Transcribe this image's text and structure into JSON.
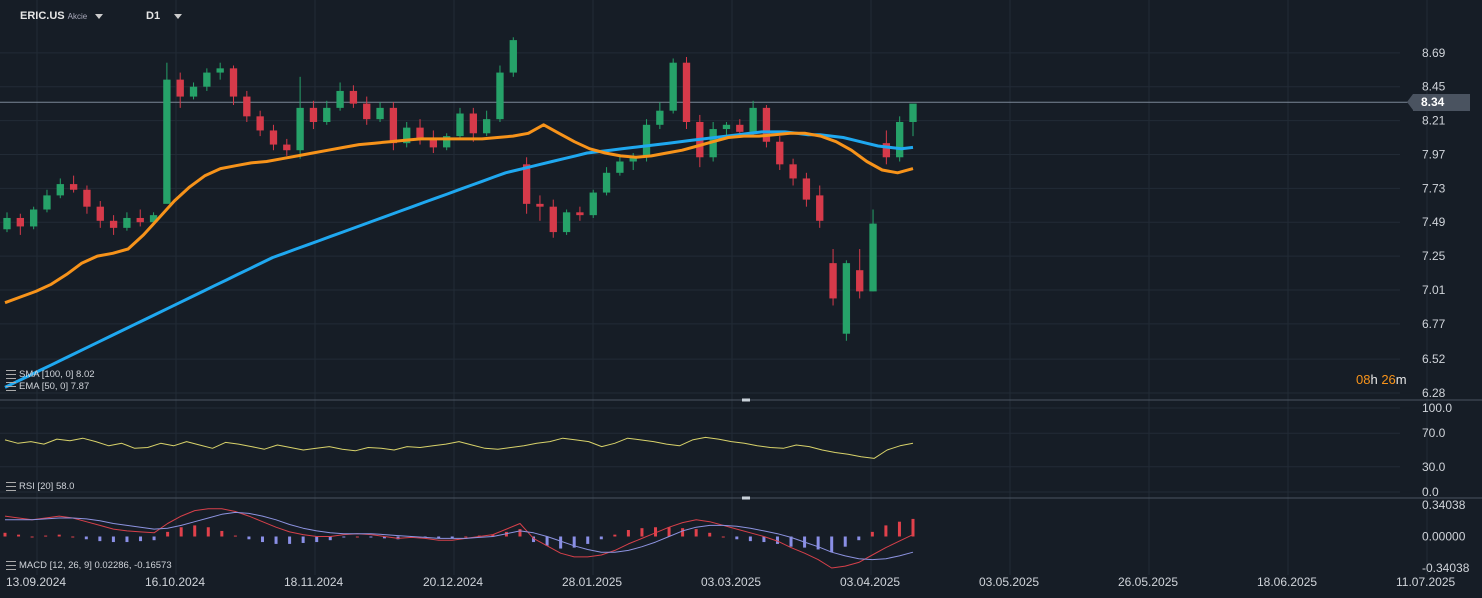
{
  "header": {
    "symbol": "ERIC.US",
    "instrument_type": "Akcie",
    "timeframe": "D1"
  },
  "timer": {
    "hours": "08",
    "h": "h",
    "minutes": "26",
    "m": "m"
  },
  "colors": {
    "background": "#161d26",
    "grid": "#222b36",
    "up_candle": "#26a269",
    "down_candle": "#d63a4a",
    "sma": "#1fa8f0",
    "ema": "#f7931a",
    "rsi": "#d8d26a",
    "macd": "#d6404a",
    "signal": "#8d93e0",
    "hist_pos": "#e0414b",
    "hist_neg": "#8a8fe6"
  },
  "chart_data": [
    {
      "type": "candlestick",
      "title": "ERIC.US",
      "current_price": "8.34",
      "ylim": [
        6.28,
        8.88
      ],
      "y_ticks": [
        "8.69",
        "8.45",
        "8.21",
        "7.97",
        "7.73",
        "7.49",
        "7.25",
        "7.01",
        "6.77",
        "6.52",
        "6.28"
      ],
      "x_ticks": [
        "13.09.2024",
        "16.10.2024",
        "18.11.2024",
        "20.12.2024",
        "28.01.2025",
        "03.03.2025",
        "03.04.2025",
        "03.05.2025",
        "26.05.2025",
        "18.06.2025",
        "11.07.2025"
      ],
      "indicators": [
        {
          "label": "SMA [100, 0] 8.02",
          "value": 8.02
        },
        {
          "label": "EMA [50, 0] 7.87",
          "value": 7.87
        }
      ],
      "sma_series": [
        6.32,
        6.36,
        6.4,
        6.44,
        6.48,
        6.52,
        6.56,
        6.6,
        6.64,
        6.68,
        6.72,
        6.76,
        6.8,
        6.84,
        6.88,
        6.92,
        6.96,
        7.0,
        7.04,
        7.08,
        7.12,
        7.16,
        7.2,
        7.24,
        7.27,
        7.3,
        7.33,
        7.36,
        7.39,
        7.42,
        7.45,
        7.48,
        7.51,
        7.54,
        7.57,
        7.6,
        7.63,
        7.66,
        7.69,
        7.72,
        7.75,
        7.78,
        7.81,
        7.84,
        7.86,
        7.88,
        7.9,
        7.92,
        7.94,
        7.96,
        7.98,
        7.99,
        8.0,
        8.01,
        8.02,
        8.03,
        8.04,
        8.05,
        8.06,
        8.07,
        8.08,
        8.09,
        8.1,
        8.11,
        8.12,
        8.13,
        8.13,
        8.13,
        8.12,
        8.11,
        8.11,
        8.1,
        8.09,
        8.07,
        8.05,
        8.03,
        8.02,
        8.01,
        8.02
      ],
      "ema_series": [
        6.92,
        6.96,
        7.0,
        7.05,
        7.12,
        7.2,
        7.25,
        7.27,
        7.3,
        7.4,
        7.52,
        7.64,
        7.74,
        7.82,
        7.87,
        7.89,
        7.91,
        7.92,
        7.94,
        7.96,
        7.98,
        8.0,
        8.02,
        8.04,
        8.05,
        8.06,
        8.07,
        8.08,
        8.08,
        8.08,
        8.08,
        8.08,
        8.09,
        8.1,
        8.12,
        8.18,
        8.12,
        8.06,
        8.01,
        7.98,
        7.96,
        7.95,
        7.96,
        7.98,
        8.0,
        8.03,
        8.06,
        8.09,
        8.1,
        8.1,
        8.11,
        8.12,
        8.12,
        8.1,
        8.06,
        8.0,
        7.92,
        7.86,
        7.84,
        7.87
      ],
      "candles": [
        [
          7.44,
          7.56,
          7.42,
          7.52
        ],
        [
          7.52,
          7.55,
          7.4,
          7.46
        ],
        [
          7.46,
          7.6,
          7.44,
          7.58
        ],
        [
          7.58,
          7.72,
          7.56,
          7.68
        ],
        [
          7.68,
          7.8,
          7.66,
          7.76
        ],
        [
          7.76,
          7.82,
          7.7,
          7.72
        ],
        [
          7.72,
          7.75,
          7.55,
          7.6
        ],
        [
          7.6,
          7.64,
          7.45,
          7.5
        ],
        [
          7.5,
          7.54,
          7.4,
          7.45
        ],
        [
          7.45,
          7.56,
          7.43,
          7.52
        ],
        [
          7.52,
          7.58,
          7.46,
          7.49
        ],
        [
          7.49,
          7.56,
          7.47,
          7.54
        ],
        [
          7.62,
          8.62,
          7.82,
          8.5
        ],
        [
          8.5,
          8.55,
          8.3,
          8.38
        ],
        [
          8.38,
          8.48,
          8.36,
          8.45
        ],
        [
          8.45,
          8.58,
          8.42,
          8.55
        ],
        [
          8.55,
          8.62,
          8.5,
          8.58
        ],
        [
          8.58,
          8.6,
          8.32,
          8.38
        ],
        [
          8.38,
          8.42,
          8.2,
          8.24
        ],
        [
          8.24,
          8.28,
          8.1,
          8.14
        ],
        [
          8.14,
          8.18,
          8.0,
          8.04
        ],
        [
          8.04,
          8.08,
          7.96,
          8.0
        ],
        [
          8.0,
          8.52,
          7.94,
          8.3
        ],
        [
          8.3,
          8.35,
          8.15,
          8.2
        ],
        [
          8.2,
          8.35,
          8.18,
          8.3
        ],
        [
          8.3,
          8.48,
          8.28,
          8.42
        ],
        [
          8.42,
          8.46,
          8.3,
          8.33
        ],
        [
          8.33,
          8.38,
          8.18,
          8.22
        ],
        [
          8.22,
          8.34,
          8.2,
          8.3
        ],
        [
          8.3,
          8.34,
          8.0,
          8.05
        ],
        [
          8.05,
          8.2,
          8.02,
          8.16
        ],
        [
          8.16,
          8.22,
          8.04,
          8.08
        ],
        [
          8.08,
          8.14,
          7.98,
          8.02
        ],
        [
          8.02,
          8.12,
          8.0,
          8.1
        ],
        [
          8.1,
          8.3,
          8.08,
          8.26
        ],
        [
          8.26,
          8.3,
          8.06,
          8.12
        ],
        [
          8.12,
          8.28,
          8.1,
          8.22
        ],
        [
          8.22,
          8.6,
          8.2,
          8.55
        ],
        [
          8.55,
          8.8,
          8.52,
          8.78
        ],
        [
          7.9,
          7.95,
          7.55,
          7.62
        ],
        [
          7.62,
          7.68,
          7.5,
          7.6
        ],
        [
          7.6,
          7.65,
          7.38,
          7.42
        ],
        [
          7.42,
          7.58,
          7.4,
          7.56
        ],
        [
          7.56,
          7.6,
          7.5,
          7.54
        ],
        [
          7.54,
          7.72,
          7.52,
          7.7
        ],
        [
          7.7,
          7.88,
          7.68,
          7.84
        ],
        [
          7.84,
          7.96,
          7.82,
          7.92
        ],
        [
          7.92,
          7.98,
          7.86,
          7.95
        ],
        [
          7.95,
          8.22,
          7.92,
          8.18
        ],
        [
          8.18,
          8.34,
          8.15,
          8.28
        ],
        [
          8.28,
          8.65,
          8.26,
          8.62
        ],
        [
          8.62,
          8.66,
          8.15,
          8.2
        ],
        [
          8.2,
          8.25,
          7.88,
          7.95
        ],
        [
          7.95,
          8.2,
          7.92,
          8.15
        ],
        [
          8.15,
          8.2,
          8.1,
          8.18
        ],
        [
          8.18,
          8.22,
          8.1,
          8.13
        ],
        [
          8.13,
          8.35,
          8.1,
          8.3
        ],
        [
          8.3,
          8.32,
          8.02,
          8.06
        ],
        [
          8.06,
          8.1,
          7.86,
          7.9
        ],
        [
          7.9,
          7.94,
          7.75,
          7.8
        ],
        [
          7.8,
          7.84,
          7.6,
          7.65
        ],
        [
          7.68,
          7.75,
          7.45,
          7.5
        ],
        [
          7.2,
          7.3,
          6.9,
          6.95
        ],
        [
          6.7,
          7.22,
          6.65,
          7.2
        ],
        [
          7.15,
          7.3,
          6.95,
          7.0
        ],
        [
          7.0,
          7.58,
          7.0,
          7.48
        ],
        [
          8.05,
          8.14,
          7.9,
          7.95
        ],
        [
          7.95,
          8.24,
          7.92,
          8.2
        ],
        [
          8.2,
          8.32,
          8.1,
          8.33
        ]
      ],
      "notes": "Candles are OHLC estimates read from the chart, in price units."
    },
    {
      "type": "line",
      "title": "RSI [20] 58.0",
      "rsi_value": 58.0,
      "ylim": [
        0,
        100
      ],
      "y_ticks": [
        "100.0",
        "70.0",
        "30.0",
        "0.0"
      ],
      "values": [
        62,
        58,
        60,
        57,
        63,
        61,
        64,
        60,
        55,
        58,
        52,
        53,
        58,
        55,
        60,
        56,
        52,
        59,
        57,
        54,
        51,
        56,
        53,
        50,
        52,
        54,
        51,
        49,
        53,
        52,
        50,
        54,
        53,
        55,
        57,
        60,
        56,
        52,
        51,
        53,
        55,
        58,
        60,
        64,
        62,
        60,
        54,
        58,
        64,
        62,
        60,
        57,
        55,
        62,
        65,
        63,
        60,
        58,
        55,
        53,
        52,
        56,
        54,
        50,
        47,
        45,
        42,
        40,
        50,
        55,
        58
      ]
    },
    {
      "type": "line",
      "title": "MACD [12, 26, 9] 0.02286, -0.16573",
      "macd_value": 0.02286,
      "signal_value": -0.16573,
      "ylim": [
        -0.34038,
        0.34038
      ],
      "y_ticks": [
        "0.34038",
        "0.00000",
        "-0.34038"
      ],
      "macd": [
        0.22,
        0.2,
        0.18,
        0.2,
        0.22,
        0.2,
        0.16,
        0.12,
        0.08,
        0.06,
        0.05,
        0.04,
        0.14,
        0.22,
        0.28,
        0.3,
        0.3,
        0.27,
        0.22,
        0.16,
        0.1,
        0.05,
        0.02,
        0.0,
        0.0,
        0.02,
        0.03,
        0.02,
        0.0,
        -0.02,
        -0.01,
        -0.02,
        -0.04,
        -0.04,
        -0.02,
        0.0,
        0.02,
        0.08,
        0.14,
        -0.02,
        -0.1,
        -0.18,
        -0.22,
        -0.22,
        -0.2,
        -0.15,
        -0.08,
        -0.02,
        0.04,
        0.1,
        0.15,
        0.18,
        0.16,
        0.12,
        0.08,
        0.04,
        0.0,
        -0.05,
        -0.12,
        -0.18,
        -0.25,
        -0.34,
        -0.32,
        -0.28,
        -0.2,
        -0.12,
        -0.05,
        0.02
      ],
      "signal": [
        0.18,
        0.18,
        0.18,
        0.19,
        0.2,
        0.2,
        0.19,
        0.17,
        0.14,
        0.12,
        0.1,
        0.08,
        0.09,
        0.12,
        0.16,
        0.2,
        0.24,
        0.26,
        0.25,
        0.22,
        0.18,
        0.13,
        0.09,
        0.06,
        0.04,
        0.03,
        0.03,
        0.03,
        0.02,
        0.01,
        0.0,
        -0.01,
        -0.02,
        -0.02,
        -0.02,
        -0.01,
        0.0,
        0.03,
        0.06,
        0.04,
        0.0,
        -0.05,
        -0.1,
        -0.14,
        -0.17,
        -0.17,
        -0.15,
        -0.11,
        -0.06,
        0.0,
        0.06,
        0.1,
        0.12,
        0.12,
        0.11,
        0.09,
        0.06,
        0.03,
        -0.01,
        -0.06,
        -0.11,
        -0.17,
        -0.21,
        -0.24,
        -0.25,
        -0.24,
        -0.21,
        -0.17
      ],
      "histogram": [
        0.04,
        0.02,
        0.0,
        0.01,
        0.02,
        0.0,
        -0.03,
        -0.05,
        -0.06,
        -0.06,
        -0.05,
        -0.04,
        0.05,
        0.1,
        0.12,
        0.1,
        0.06,
        0.01,
        -0.03,
        -0.06,
        -0.08,
        -0.08,
        -0.07,
        -0.06,
        -0.04,
        -0.01,
        0.0,
        -0.01,
        -0.02,
        -0.03,
        -0.01,
        -0.01,
        -0.02,
        -0.02,
        0.0,
        0.01,
        0.02,
        0.05,
        0.08,
        -0.06,
        -0.1,
        -0.13,
        -0.12,
        -0.08,
        -0.03,
        0.02,
        0.07,
        0.09,
        0.1,
        0.1,
        0.09,
        0.08,
        0.04,
        0.0,
        -0.03,
        -0.05,
        -0.06,
        -0.08,
        -0.11,
        -0.12,
        -0.14,
        -0.17,
        -0.11,
        -0.04,
        0.05,
        0.12,
        0.16,
        0.19
      ]
    }
  ]
}
